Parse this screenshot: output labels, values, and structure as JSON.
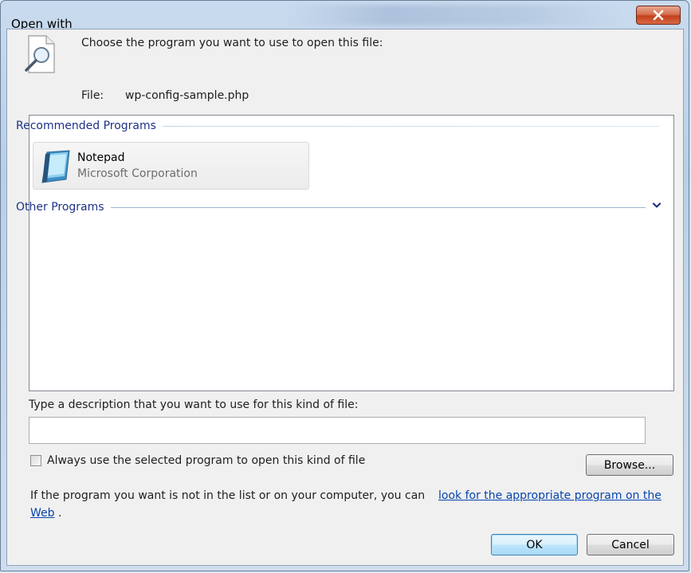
{
  "window": {
    "title": "Open with",
    "close_glyph": "x"
  },
  "header": {
    "prompt": "Choose the program you want to use to open this file:",
    "file_label": "File:",
    "file_name": "wp-config-sample.php",
    "icon": "magnifier-document-icon"
  },
  "programs": {
    "recommended_header": "Recommended Programs",
    "items": [
      {
        "name": "Notepad",
        "company": "Microsoft Corporation",
        "icon": "notepad-icon"
      }
    ],
    "other_header": "Other Programs",
    "other_expand_icon": "chevron-down-icon"
  },
  "description": {
    "label": "Type a description that you want to use for this kind of file:",
    "value": ""
  },
  "always_use": {
    "label": "Always use the selected program to open this kind of file",
    "checked": false
  },
  "buttons": {
    "browse": "Browse...",
    "ok": "OK",
    "cancel": "Cancel"
  },
  "help": {
    "text": "If the program you want is not in the list or on your computer, you can",
    "link_part1": "look for the appropriate program on the",
    "link_part2": "Web",
    "end": "."
  },
  "colors": {
    "link": "#0645ad",
    "group_header": "#1e3287",
    "close_button": "#c4401c"
  }
}
